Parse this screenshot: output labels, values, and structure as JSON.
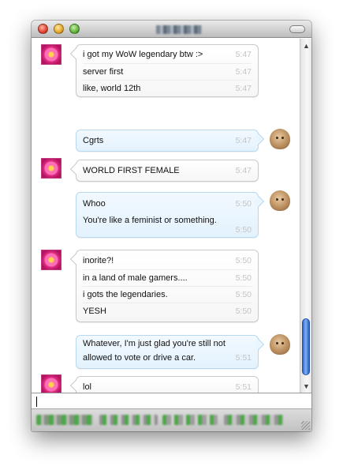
{
  "window": {
    "title": ""
  },
  "colors": {
    "incoming_bubble": "#ffffff",
    "outgoing_bubble": "#e3f2fd",
    "timestamp": "#c4c4c4",
    "scroll_thumb": "#2f64c9"
  },
  "icons": {
    "sender_avatar": "pink-flower-avatar",
    "receiver_avatar": "bald-figure-avatar"
  },
  "messages": [
    {
      "from": "them",
      "lines": [
        {
          "text": "i got my WoW legendary btw :>",
          "time": "5:47"
        },
        {
          "text": "server first",
          "time": "5:47"
        },
        {
          "text": "like, world 12th",
          "time": "5:47"
        }
      ]
    },
    {
      "from": "me",
      "lines": [
        {
          "text": "Cgrts",
          "time": "5:47"
        }
      ]
    },
    {
      "from": "them",
      "lines": [
        {
          "text": "WORLD FIRST FEMALE",
          "time": "5:47"
        }
      ]
    },
    {
      "from": "me",
      "lines": [
        {
          "text": "Whoo",
          "time": "5:50"
        },
        {
          "text": "You're like a feminist or something.",
          "time": "5:50"
        }
      ]
    },
    {
      "from": "them",
      "lines": [
        {
          "text": "inorite?!",
          "time": "5:50"
        },
        {
          "text": "in a land of male gamers....",
          "time": "5:50"
        },
        {
          "text": "i gots the legendaries.",
          "time": "5:50"
        },
        {
          "text": "YESH",
          "time": "5:50"
        }
      ]
    },
    {
      "from": "me",
      "lines": [
        {
          "text": "Whatever, I'm just glad you're still not",
          "time": ""
        },
        {
          "text": "allowed to vote or drive a car.",
          "time": "5:51"
        }
      ]
    },
    {
      "from": "them",
      "lines": [
        {
          "text": "lol",
          "time": "5:51"
        }
      ]
    }
  ],
  "input": {
    "value": ""
  },
  "scroll": {
    "position_fraction": 0.92
  }
}
